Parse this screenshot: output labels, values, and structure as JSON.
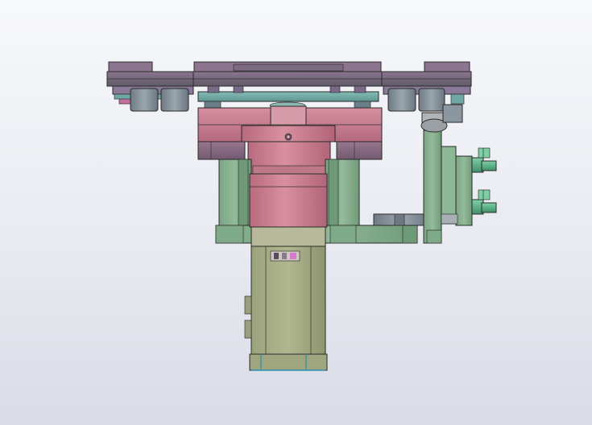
{
  "viewport": {
    "background_top": "#f7f8fb",
    "background_bottom": "#d9dce6"
  },
  "palette": {
    "top_plate": "#6e6a72",
    "top_plate_accent": "#7a5d7c",
    "grey_blocks": "#7f8a93",
    "teal_plate": "#6fa7a2",
    "gearbox_pink": "#c8788b",
    "gearbox_pink_light": "#d6909f",
    "gearbox_mauve": "#8d6d86",
    "bracket_green": "#88b08f",
    "bracket_green_dark": "#6f9a78",
    "motor_olive": "#a7ad86",
    "motor_olive_dark": "#8f9670",
    "fitting_green": "#5fb08a",
    "sensor_label": "#d67ad0"
  },
  "icons": {
    "assembly": "cad-assembly-drawing",
    "fitting": "pneumatic-fitting-icon"
  }
}
